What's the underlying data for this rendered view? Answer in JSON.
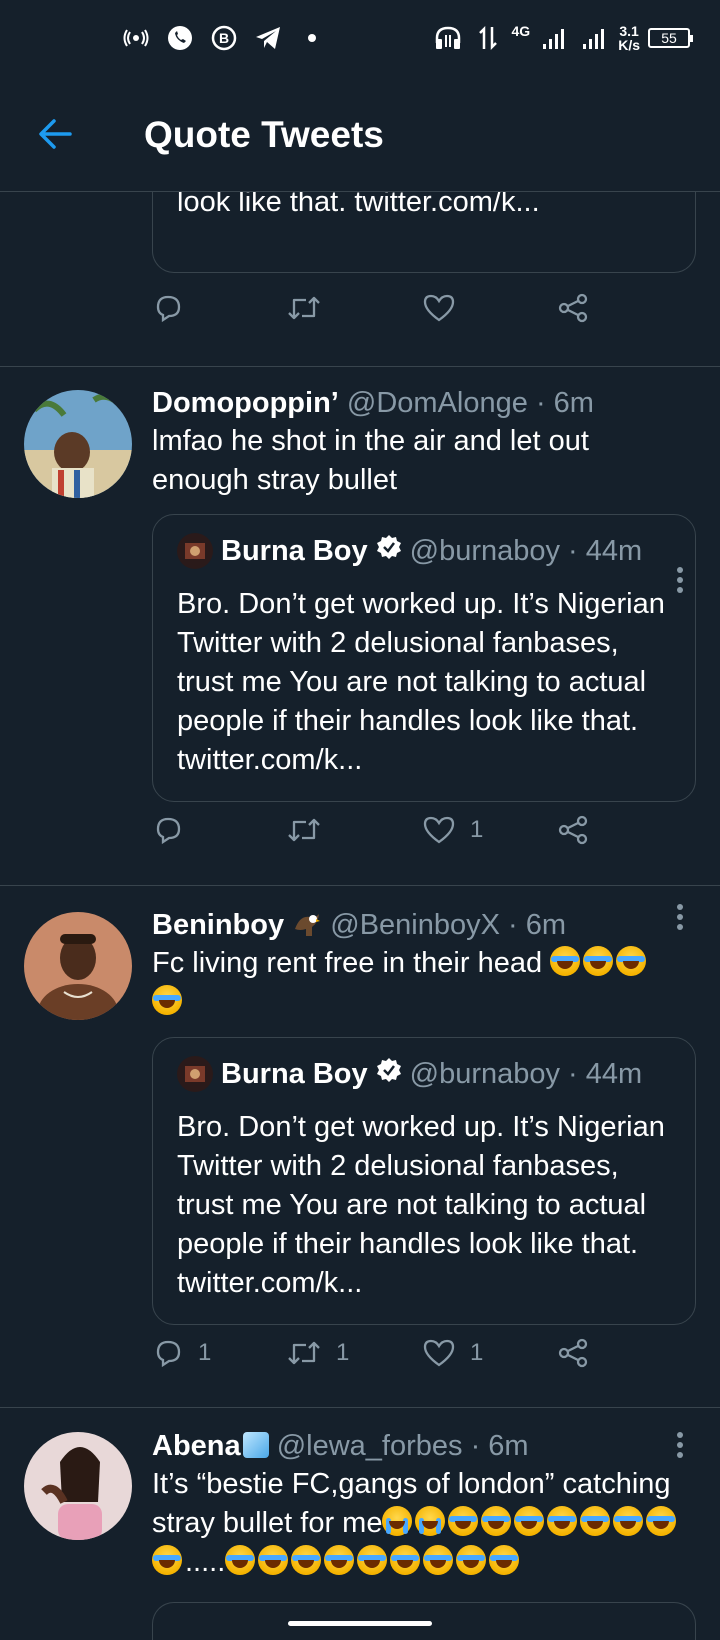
{
  "status_bar": {
    "network_label": "4G",
    "speed_value": "3.1",
    "speed_unit": "K/s",
    "battery_level": "55"
  },
  "header": {
    "title": "Quote Tweets"
  },
  "tweets": [
    {
      "quote_text_partial": "talking to actual people if their handles look like that. twitter.com/k...",
      "reply_count": "",
      "retweet_count": "",
      "like_count": ""
    },
    {
      "name": "Domopoppin’",
      "handle": "@DomAlonge",
      "time": "· 6m",
      "text": "lmfao he shot in the air and let out enough stray bullet",
      "quote": {
        "name": "Burna Boy",
        "handle": "@burnaboy",
        "time": "· 44m",
        "text": "Bro. Don’t get worked up. It’s Nigerian Twitter with 2 delusional fanbases, trust me You are not talking to actual people if their handles look like that. twitter.com/k..."
      },
      "reply_count": "",
      "retweet_count": "",
      "like_count": "1"
    },
    {
      "name": "Beninboy",
      "handle": "@BeninboyX",
      "time": "· 6m",
      "text": "Fc living rent free in their head",
      "quote": {
        "name": "Burna Boy",
        "handle": "@burnaboy",
        "time": "· 44m",
        "text": "Bro. Don’t get worked up. It’s Nigerian Twitter with 2 delusional fanbases, trust me You are not talking to actual people if their handles look like that. twitter.com/k..."
      },
      "reply_count": "1",
      "retweet_count": "1",
      "like_count": "1"
    },
    {
      "name": "Abena",
      "handle": "@lewa_forbes",
      "time": "· 6m",
      "text_part1": "It’s “bestie FC,gangs of london” catching stray bullet for me",
      "text_dots": "....."
    }
  ],
  "colors": {
    "background": "#15202b",
    "border": "#38444d",
    "secondary_text": "#8899a6",
    "accent": "#1d9bf0"
  },
  "icons": [
    "back-arrow-icon",
    "reply-icon",
    "retweet-icon",
    "like-icon",
    "share-icon",
    "more-icon",
    "verified-icon"
  ]
}
